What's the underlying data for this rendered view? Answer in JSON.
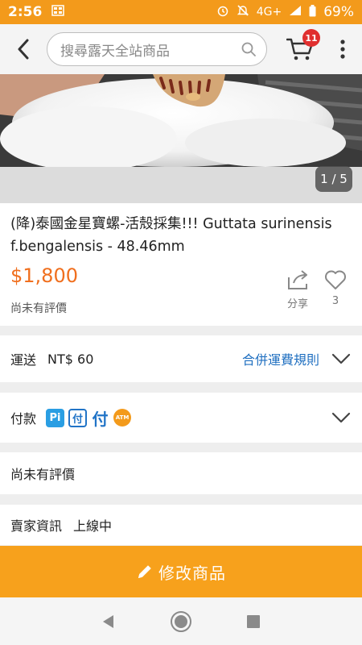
{
  "status_bar": {
    "time": "2:56",
    "network": "4G+",
    "battery": "69%"
  },
  "header": {
    "search_placeholder": "搜尋露天全站商品",
    "cart_count": "11"
  },
  "photo": {
    "counter": "1 / 5"
  },
  "product": {
    "title": "(降)泰國金星寶螺-活殼採集!!! Guttata surinensis f.bengalensis - 48.46mm",
    "price": "$1,800",
    "rating_text": "尚未有評價",
    "share_label": "分享",
    "like_count": "3"
  },
  "shipping": {
    "label": "運送",
    "fee": "NT$ 60",
    "rule_link": "合併運費規則"
  },
  "payment": {
    "label": "付款",
    "icons": [
      "pi-wallet-icon",
      "fu-pay-icon",
      "fu-pay-outline-icon",
      "atm-icon"
    ],
    "pi_text": "Pi",
    "fu_text": "付",
    "atm_text": "ATM"
  },
  "reviews": {
    "text": "尚未有評價"
  },
  "seller": {
    "label": "賣家資訊",
    "status": "上線中"
  },
  "edit_button": {
    "label": "修改商品"
  },
  "colors": {
    "accent": "#f39a1b",
    "price": "#f06f1e",
    "link": "#1f6fc0",
    "badge": "#e02f2f"
  }
}
